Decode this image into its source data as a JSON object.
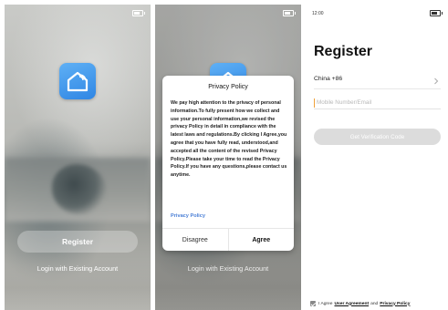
{
  "screen1": {
    "register_label": "Register",
    "login_label": "Login with Existing Account"
  },
  "screen2": {
    "dialog_title": "Privacy Policy",
    "dialog_body": "We pay high attention to the privacy of personal information.To fully present how we collect and use your personal information,we revised the privacy Policy in detail in compliance with the latest laws and regulations.By clicking I Agree,you agree that you have fully read, understood,and accepted all the content of the revised Privacy Policy.Please take your time to read the Privacy Policy.If you have any questions,please contact us anytime.",
    "privacy_link": "Privacy Policy",
    "disagree_label": "Disagree",
    "agree_label": "Agree",
    "login_label": "Login with Existing Account"
  },
  "screen3": {
    "status_time": "12:00",
    "title": "Register",
    "country": "China +86",
    "mobile_placeholder": "Mobile Number/Email",
    "verify_label": "Get Verification Code",
    "agree_prefix": "I Agree",
    "user_agreement": "User Agreement",
    "and": "and",
    "privacy_policy": "Privacy Policy"
  },
  "colors": {
    "app_icon": "#3b8fe8",
    "link": "#4a7fd6",
    "disabled_button": "#dcdcdc",
    "cursor": "#f0a13a"
  },
  "icons": {
    "app_logo": "smart-home-icon",
    "country_chevron": "chevron-right-icon",
    "checkbox": "checkbox-checked-icon",
    "battery": "battery-icon"
  }
}
